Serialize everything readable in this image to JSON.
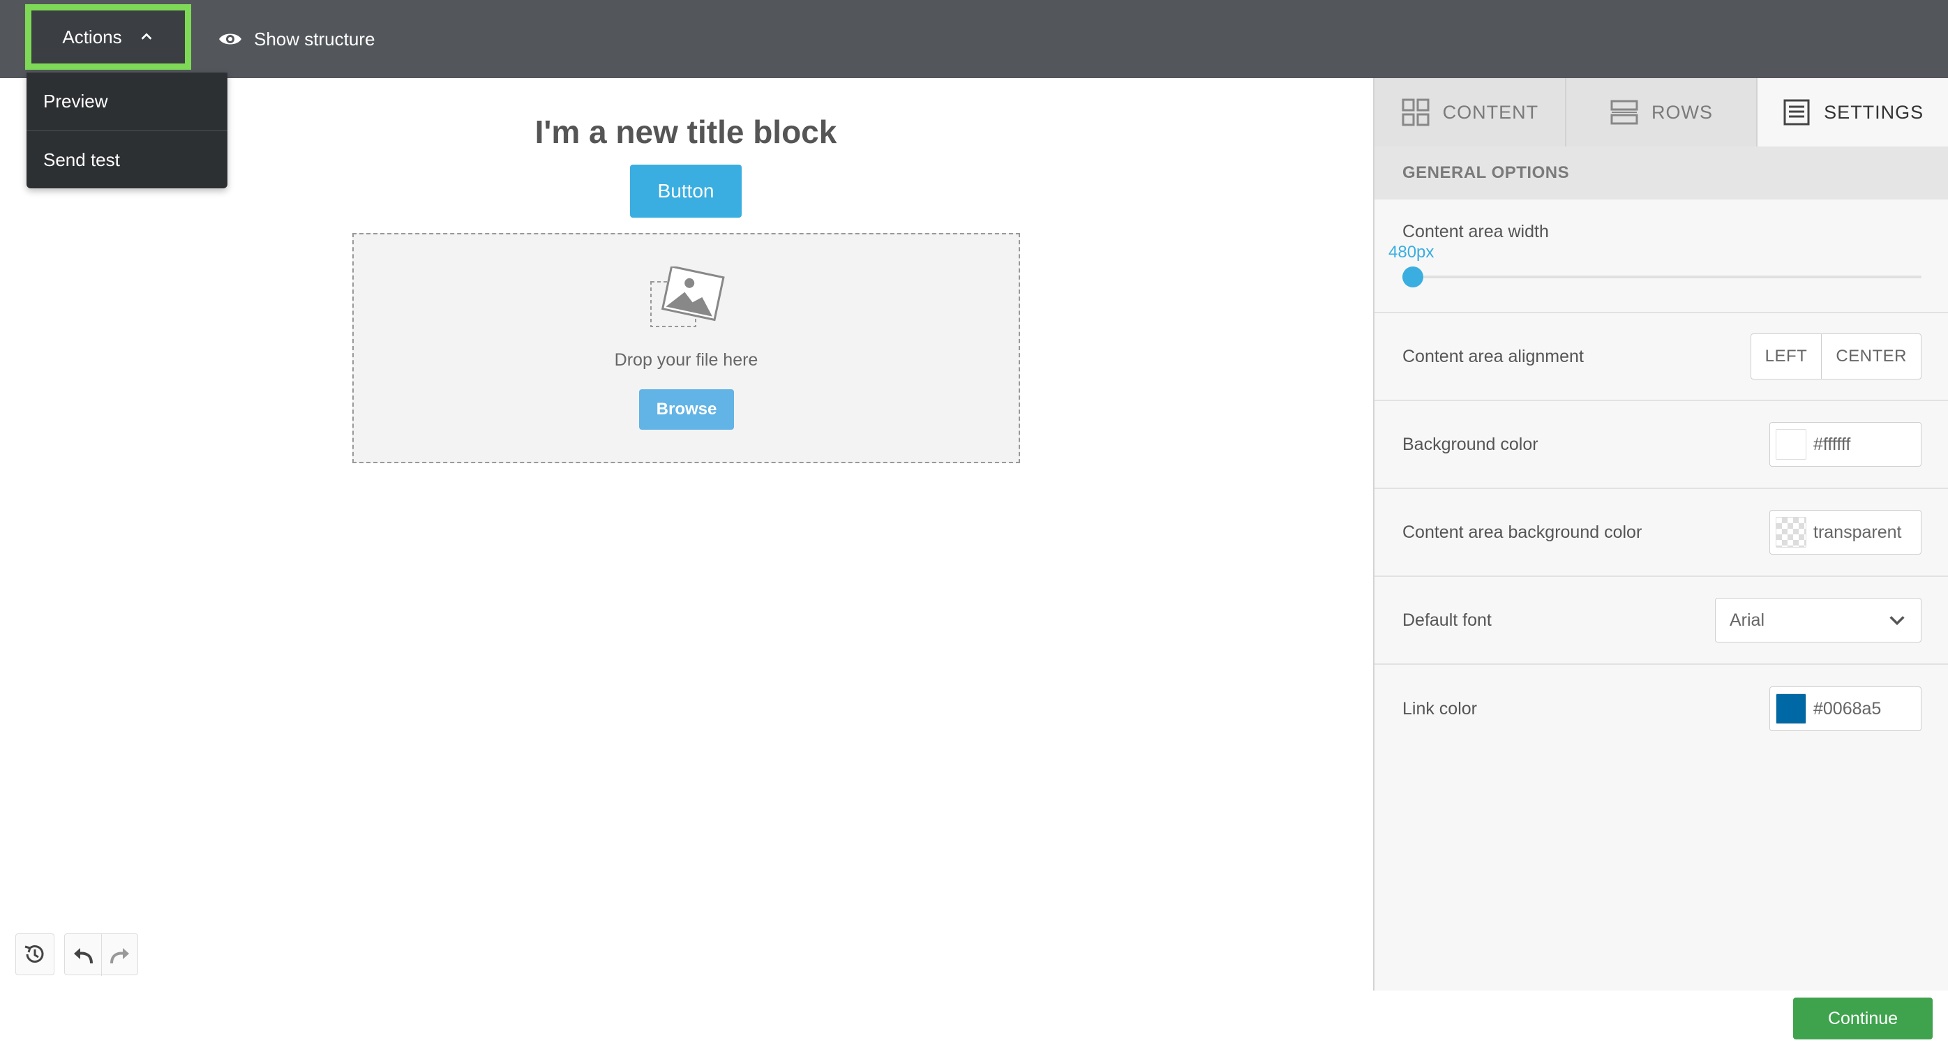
{
  "topbar": {
    "actions_label": "Actions",
    "show_structure_label": "Show structure"
  },
  "actions_menu": {
    "items": [
      {
        "label": "Preview"
      },
      {
        "label": "Send test"
      }
    ]
  },
  "canvas": {
    "title_text": "I'm a new title block",
    "button_label": "Button",
    "dropzone": {
      "drop_text": "Drop your file here",
      "browse_label": "Browse",
      "icon": "image-placeholder-icon"
    }
  },
  "history": {
    "icons": [
      "history-icon",
      "undo-icon",
      "redo-icon"
    ]
  },
  "sidebar": {
    "tabs": [
      {
        "label": "CONTENT",
        "icon": "grid-icon",
        "active": false
      },
      {
        "label": "ROWS",
        "icon": "rows-icon",
        "active": false
      },
      {
        "label": "SETTINGS",
        "icon": "settings-doc-icon",
        "active": true
      }
    ],
    "section_title": "GENERAL OPTIONS",
    "content_width": {
      "label": "Content area width",
      "value": "480px"
    },
    "alignment": {
      "label": "Content area alignment",
      "options": [
        "LEFT",
        "CENTER"
      ]
    },
    "background_color": {
      "label": "Background color",
      "value": "#ffffff",
      "swatch": "#ffffff"
    },
    "content_bg_color": {
      "label": "Content area background color",
      "value": "transparent"
    },
    "default_font": {
      "label": "Default font",
      "value": "Arial"
    },
    "link_color": {
      "label": "Link color",
      "value": "#0068a5",
      "swatch": "#0068a5"
    }
  },
  "footer": {
    "continue_label": "Continue"
  },
  "colors": {
    "accent_blue": "#3aaee0",
    "highlight_green": "#7ed957",
    "continue_green": "#3fa34d",
    "topbar": "#53575b"
  }
}
